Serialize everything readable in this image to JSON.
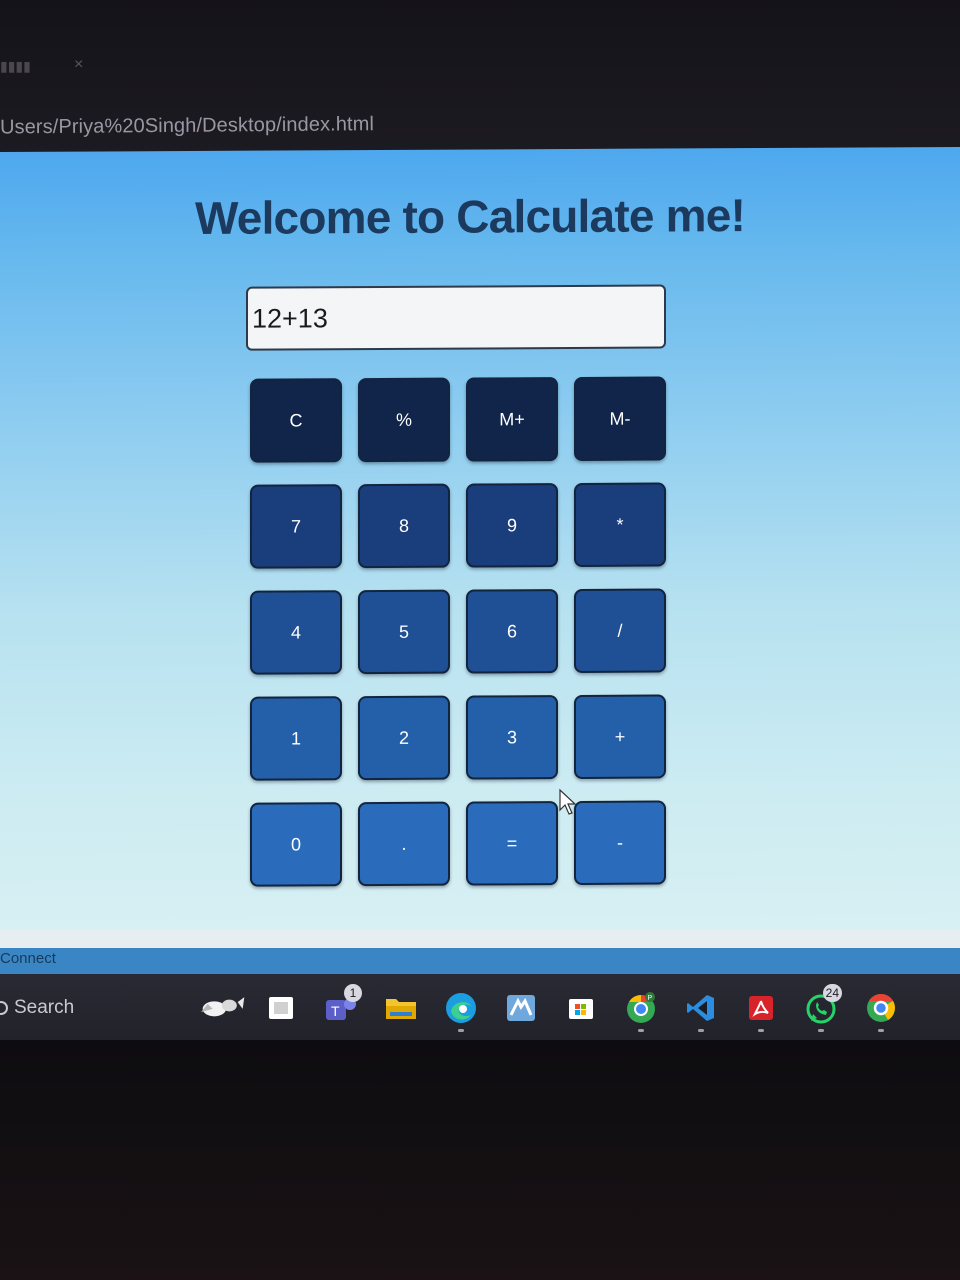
{
  "browser": {
    "address": "Users/Priya%20Singh/Desktop/index.html"
  },
  "page": {
    "title": "Welcome to Calculate me!",
    "display_value": "12+13",
    "keys": [
      [
        "C",
        "%",
        "M+",
        "M-"
      ],
      [
        "7",
        "8",
        "9",
        "*"
      ],
      [
        "4",
        "5",
        "6",
        "/"
      ],
      [
        "1",
        "2",
        "3",
        "+"
      ],
      [
        "0",
        ".",
        "=",
        "-"
      ]
    ]
  },
  "status_strip": {
    "label": "Connect"
  },
  "taskbar": {
    "search_label": "Search",
    "icons": [
      {
        "name": "widgets-icon"
      },
      {
        "name": "task-view-icon"
      },
      {
        "name": "teams-icon",
        "badge": "1"
      },
      {
        "name": "file-explorer-icon"
      },
      {
        "name": "edge-icon"
      },
      {
        "name": "matlab-icon"
      },
      {
        "name": "microsoft-store-icon"
      },
      {
        "name": "chrome-profile-icon"
      },
      {
        "name": "vscode-icon"
      },
      {
        "name": "acrobat-icon"
      },
      {
        "name": "whatsapp-icon",
        "badge": "24"
      },
      {
        "name": "chrome-icon"
      }
    ]
  },
  "colors": {
    "title": "#1b3a5e",
    "page_top": "#4ea8ee",
    "page_bottom": "#d8f0f3",
    "key_top_row": "#11244a",
    "key_bottom_row": "#2a6cbb"
  }
}
